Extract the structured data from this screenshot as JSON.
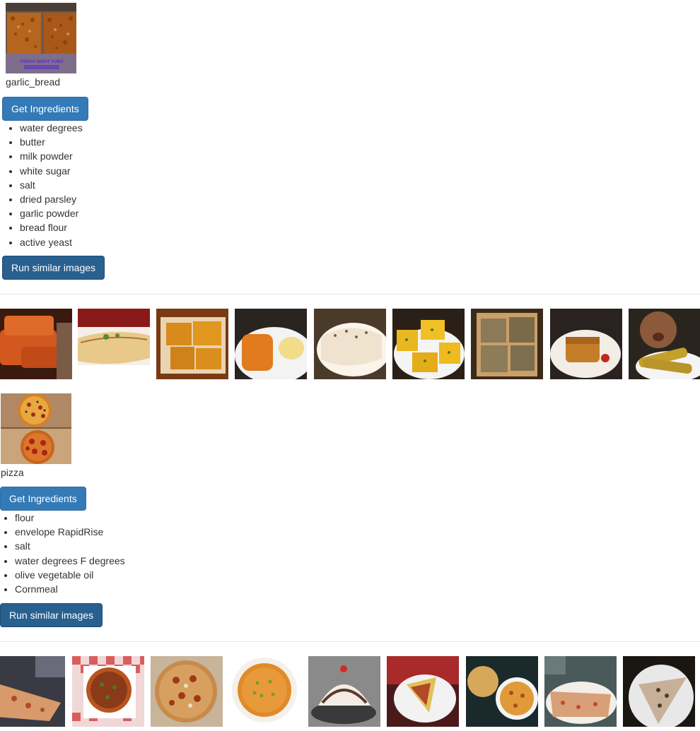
{
  "foods": [
    {
      "label": "garlic_bread",
      "get_ingredients_label": "Get Ingredients",
      "ingredients": [
        "water degrees",
        "butter",
        "milk powder",
        "white sugar",
        "salt",
        "dried parsley",
        "garlic powder",
        "bread flour",
        "active yeast"
      ],
      "run_similar_label": "Run similar images",
      "query_image_caption": "FRIDAY NIGHT YUMS",
      "similar_images_count": 9
    },
    {
      "label": "pizza",
      "get_ingredients_label": "Get Ingredients",
      "ingredients": [
        "flour",
        "envelope RapidRise",
        "salt",
        "water degrees F degrees",
        "olive vegetable oil",
        "Cornmeal"
      ],
      "run_similar_label": "Run similar images",
      "similar_images_count": 9
    }
  ],
  "colors": {
    "primary": "#337ab7",
    "primary_active": "#286090",
    "text": "#333333",
    "separator": "#e6e6e6"
  }
}
